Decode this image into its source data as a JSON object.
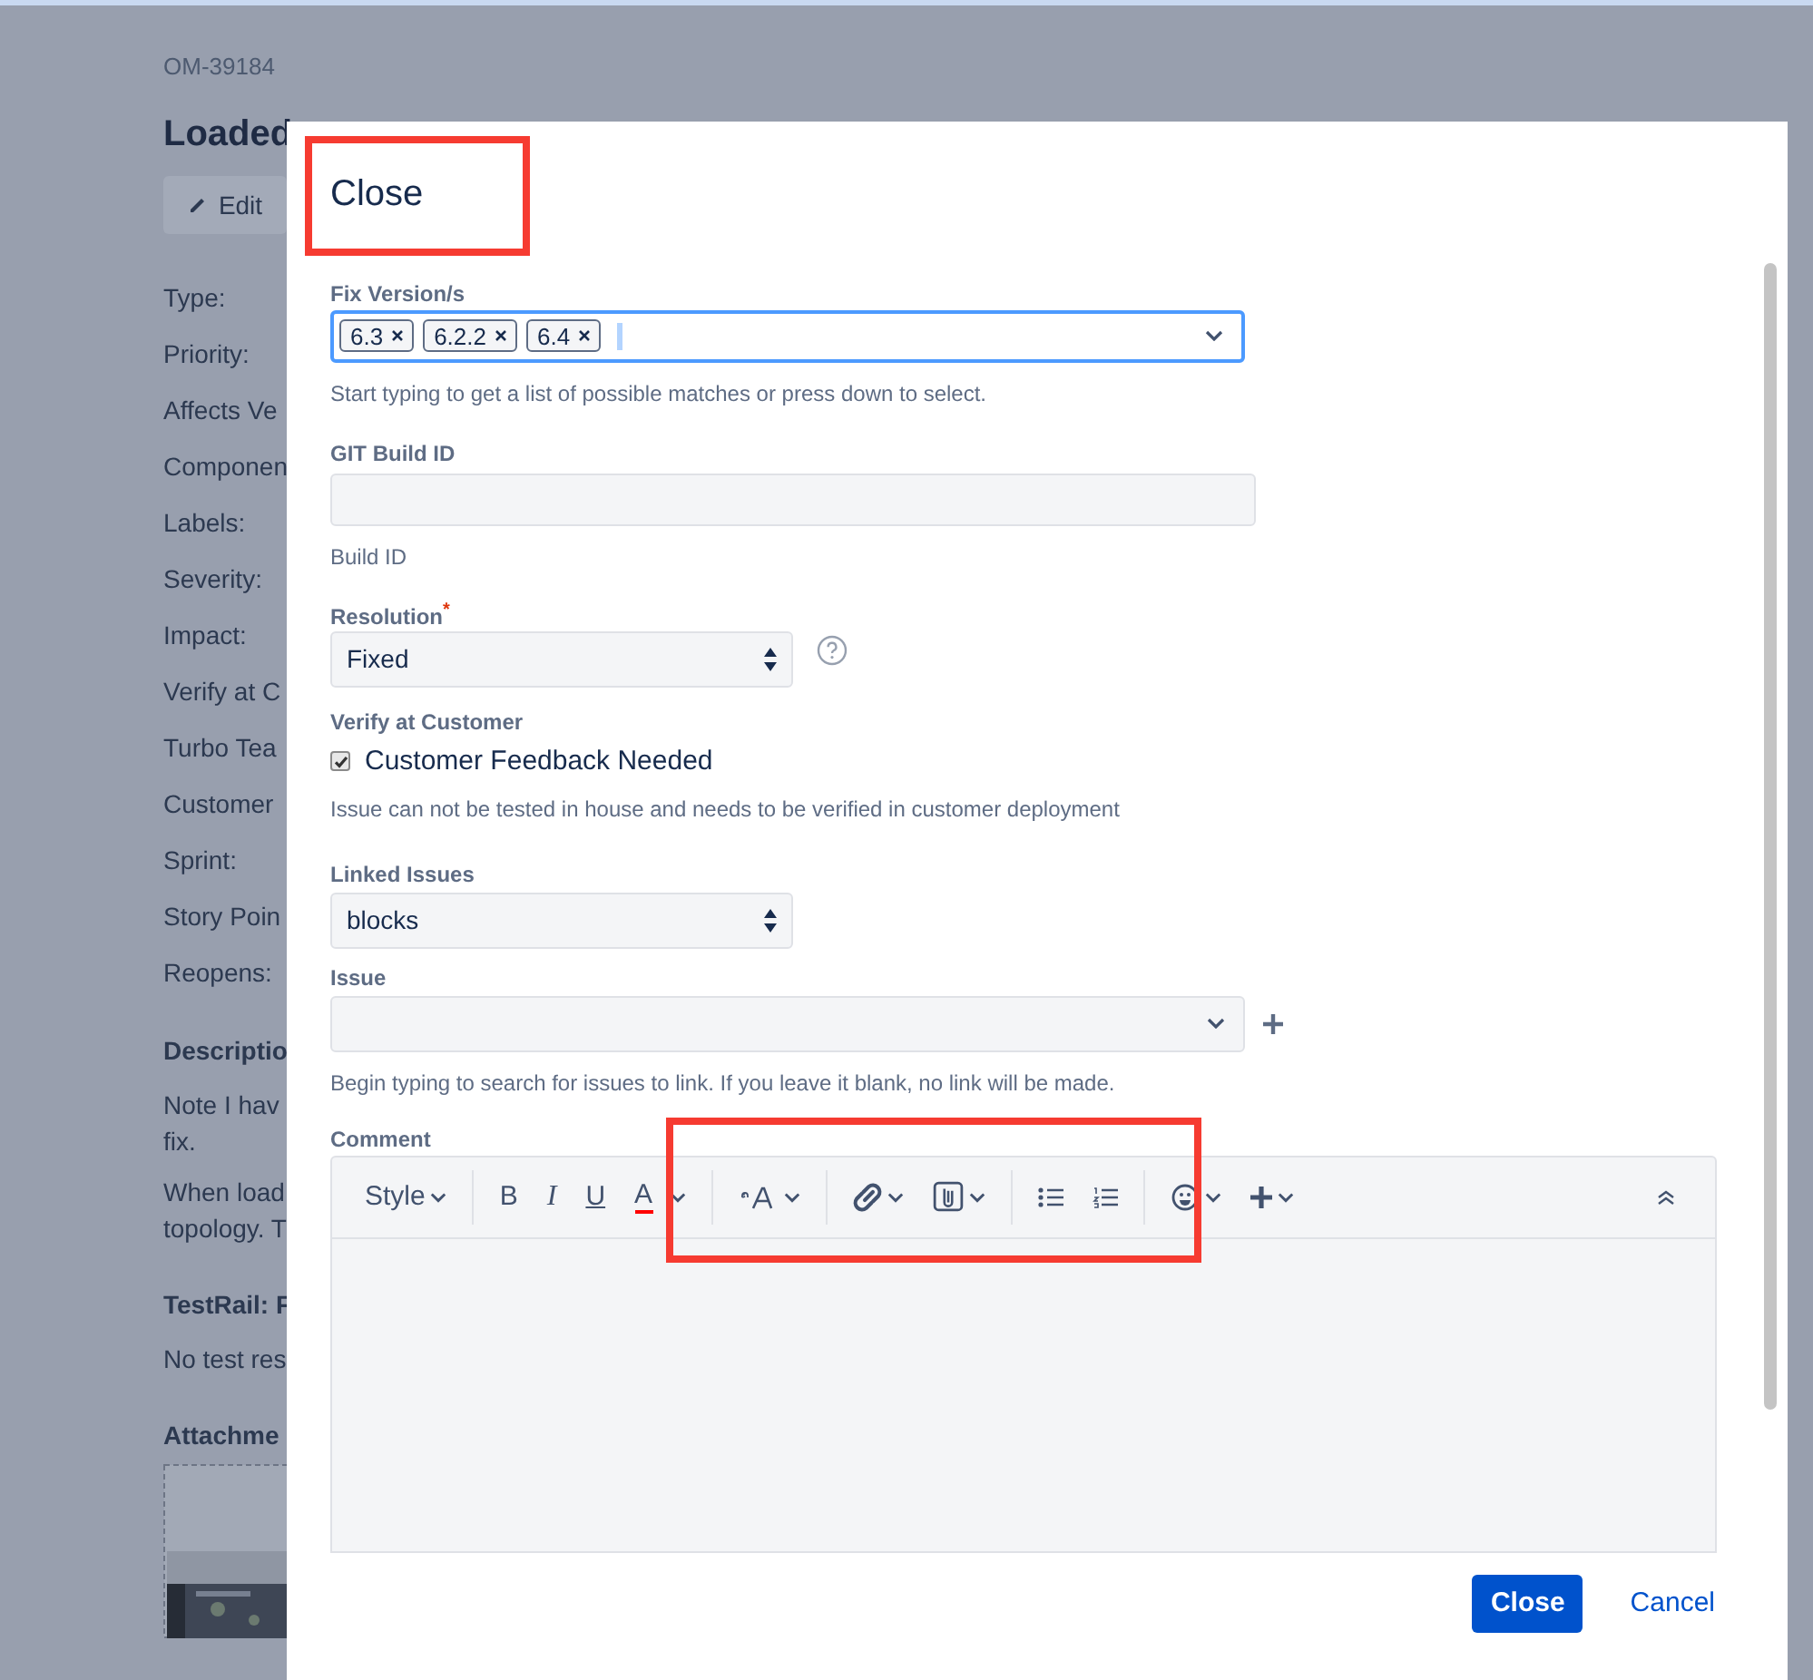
{
  "issue_page": {
    "key": "OM-39184",
    "title": "Loaded",
    "edit_button": "Edit",
    "field_labels": [
      "Type:",
      "Priority:",
      "Affects Ve",
      "Componen",
      "Labels:",
      "Severity:",
      "Impact:",
      "Verify at C",
      "Turbo Tea",
      "Customer",
      "Sprint:",
      "Story Poin",
      "Reopens:"
    ],
    "sections": [
      {
        "heading": "Descriptio",
        "paragraphs": [
          [
            "Note I hav",
            "fix."
          ],
          [
            "When load",
            "topology. T"
          ]
        ]
      },
      {
        "heading": "TestRail: F",
        "paragraphs": [
          [
            "No test res"
          ]
        ]
      },
      {
        "heading": "Attachme"
      }
    ]
  },
  "dialog": {
    "title": "Close",
    "fields": [
      {
        "kind": "multiselect",
        "label": "Fix Version/s",
        "tags": [
          "6.3",
          "6.2.2",
          "6.4"
        ],
        "focused": true,
        "hint": "Start typing to get a list of possible matches or press down to select."
      },
      {
        "kind": "text",
        "label": "GIT Build ID",
        "hint": "Build ID"
      },
      {
        "kind": "select",
        "label": "Resolution",
        "required_mark": "*",
        "value": "Fixed",
        "help": true
      },
      {
        "kind": "checkbox",
        "label": "Verify at Customer",
        "option": "Customer Feedback Needed",
        "checked": true,
        "hint": "Issue can not be tested in house and needs to be verified in customer deployment"
      },
      {
        "kind": "select",
        "label": "Linked Issues",
        "value": "blocks"
      },
      {
        "kind": "combobox",
        "label": "Issue",
        "add": true,
        "hint": "Begin typing to search for issues to link. If you leave it blank, no link will be made."
      },
      {
        "kind": "editor",
        "label": "Comment",
        "toolbar": [
          {
            "kind": "style",
            "label": "Style",
            "dropdown": true
          },
          {
            "kind": "divider"
          },
          {
            "kind": "bold",
            "label": "B"
          },
          {
            "kind": "italic",
            "label": "I"
          },
          {
            "kind": "underline",
            "label": "U"
          },
          {
            "kind": "color",
            "label": "A",
            "dropdown": true
          },
          {
            "kind": "divider"
          },
          {
            "kind": "font-size",
            "dropdown": true
          },
          {
            "kind": "divider"
          },
          {
            "kind": "link",
            "dropdown": true
          },
          {
            "kind": "attachment",
            "dropdown": true
          },
          {
            "kind": "divider"
          },
          {
            "kind": "bullet-list"
          },
          {
            "kind": "numbered-list"
          },
          {
            "kind": "divider"
          },
          {
            "kind": "emoji",
            "dropdown": true
          },
          {
            "kind": "insert",
            "dropdown": true
          },
          {
            "kind": "collapse"
          }
        ]
      }
    ],
    "buttons": [
      {
        "label": "Close",
        "kind": "primary"
      },
      {
        "label": "Cancel",
        "kind": "link"
      }
    ]
  }
}
